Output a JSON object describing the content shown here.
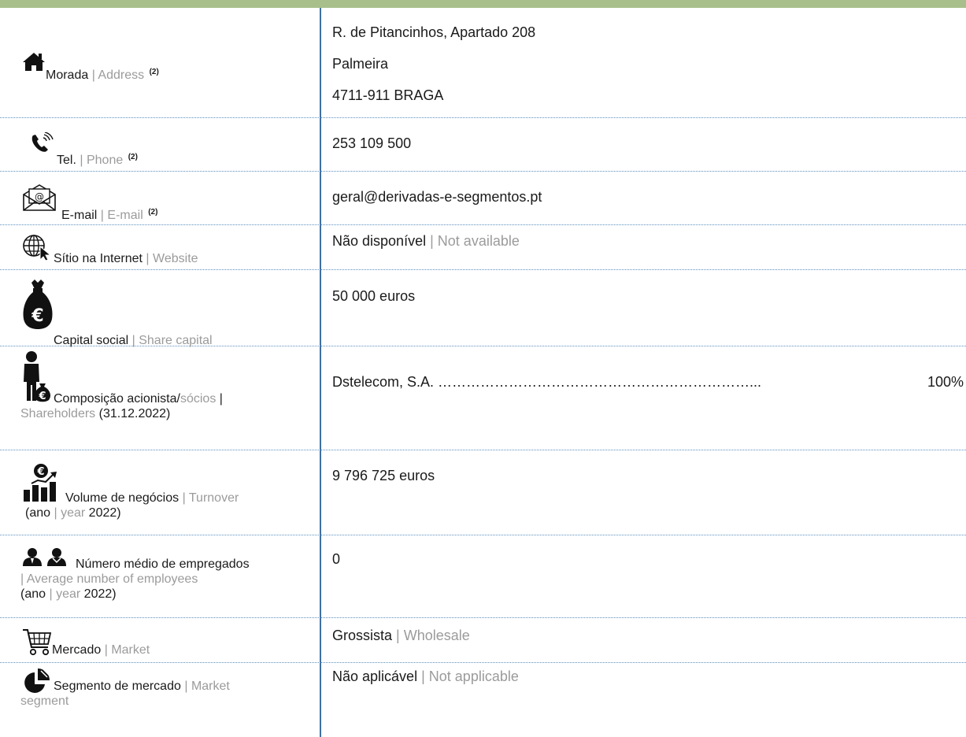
{
  "rows": [
    {
      "label_pt": "Morada",
      "label_en": "Address",
      "note": "(2)",
      "icon": "home-icon",
      "lines": [
        "R. de Pitancinhos, Apartado 208",
        "Palmeira",
        "4711-911 BRAGA"
      ]
    },
    {
      "label_pt": "Tel.",
      "label_en": "Phone",
      "note": "(2)",
      "icon": "phone-icon",
      "value": "253 109 500"
    },
    {
      "label_pt": "E-mail",
      "label_en": "E-mail",
      "note": "(2)",
      "icon": "mail-icon",
      "value": "geral@derivadas-e-segmentos.pt"
    },
    {
      "label_pt": "Sítio na Internet",
      "label_en": "Website",
      "icon": "globe-cursor-icon",
      "value_pt": "Não disponível",
      "value_en": "Not available"
    },
    {
      "label_pt": "Capital social",
      "label_en": "Share capital",
      "icon": "money-bag-euro-icon",
      "value": "50 000 euros"
    },
    {
      "label_pt": "Composição acionista/",
      "label_pt2": "sócios",
      "label_en": "Shareholders",
      "date": "(31.12.2022)",
      "icon": "person-with-money-bag-icon",
      "shareholder_name": "Dstelecom, S.A. ",
      "shareholder_dots": "…………………………………………………………...",
      "shareholder_pct": "100%"
    },
    {
      "label_pt": "Volume de negócios",
      "label_en": "Turnover",
      "year_pt": "(ano",
      "year_en": "year",
      "year_val": "2022)",
      "icon": "bar-chart-euro-icon",
      "value": "9 796 725 euros"
    },
    {
      "label_pt": "Número médio de empregados",
      "label_en": "| Average number of employees",
      "year_pt": "(ano",
      "year_en": "year",
      "year_val": "2022)",
      "icon": "employees-icon",
      "value": "0"
    },
    {
      "label_pt": "Mercado",
      "label_en": "Market",
      "icon": "shopping-cart-icon",
      "value_pt": "Grossista",
      "value_en": "Wholesale"
    },
    {
      "label_pt": "Segmento de mercado",
      "label_en": "Market",
      "label_en2": "segment",
      "icon": "pie-segment-icon",
      "value_pt": "Não aplicável",
      "value_en": "Not applicable"
    }
  ],
  "separator": "|",
  "colors": {
    "topbar": "#a9bf8b",
    "divider": "#3f6fa3",
    "row_border": "#5b8fbf",
    "english_text": "#9b9b9b"
  }
}
